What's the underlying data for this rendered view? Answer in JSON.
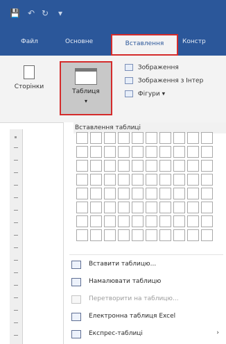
{
  "ribbon_tabs": [
    {
      "label": "Файл"
    },
    {
      "label": "Основне"
    },
    {
      "label": "Вставлення",
      "active": true
    },
    {
      "label": "Констр"
    }
  ],
  "ribbon": {
    "pages_button_label": "Сторінки",
    "table_button_label": "Таблиця",
    "insert_options": [
      {
        "label": "Зображення"
      },
      {
        "label": "Зображення з Інтер"
      },
      {
        "label": "Фігури"
      }
    ]
  },
  "dropdown": {
    "title": "Вставлення таблиці",
    "grid": {
      "columns": 10,
      "rows": 8
    },
    "menu_items": [
      {
        "label": "Вставити таблицю..."
      },
      {
        "label": "Намалювати таблицю"
      },
      {
        "label": "Перетворити на таблицю...",
        "disabled": true
      },
      {
        "label": "Електронна таблиця Excel"
      },
      {
        "label": "Експрес-таблиці",
        "has_submenu": true
      }
    ]
  },
  "colors": {
    "accent": "#2b579a",
    "highlight": "#d42b2b"
  }
}
